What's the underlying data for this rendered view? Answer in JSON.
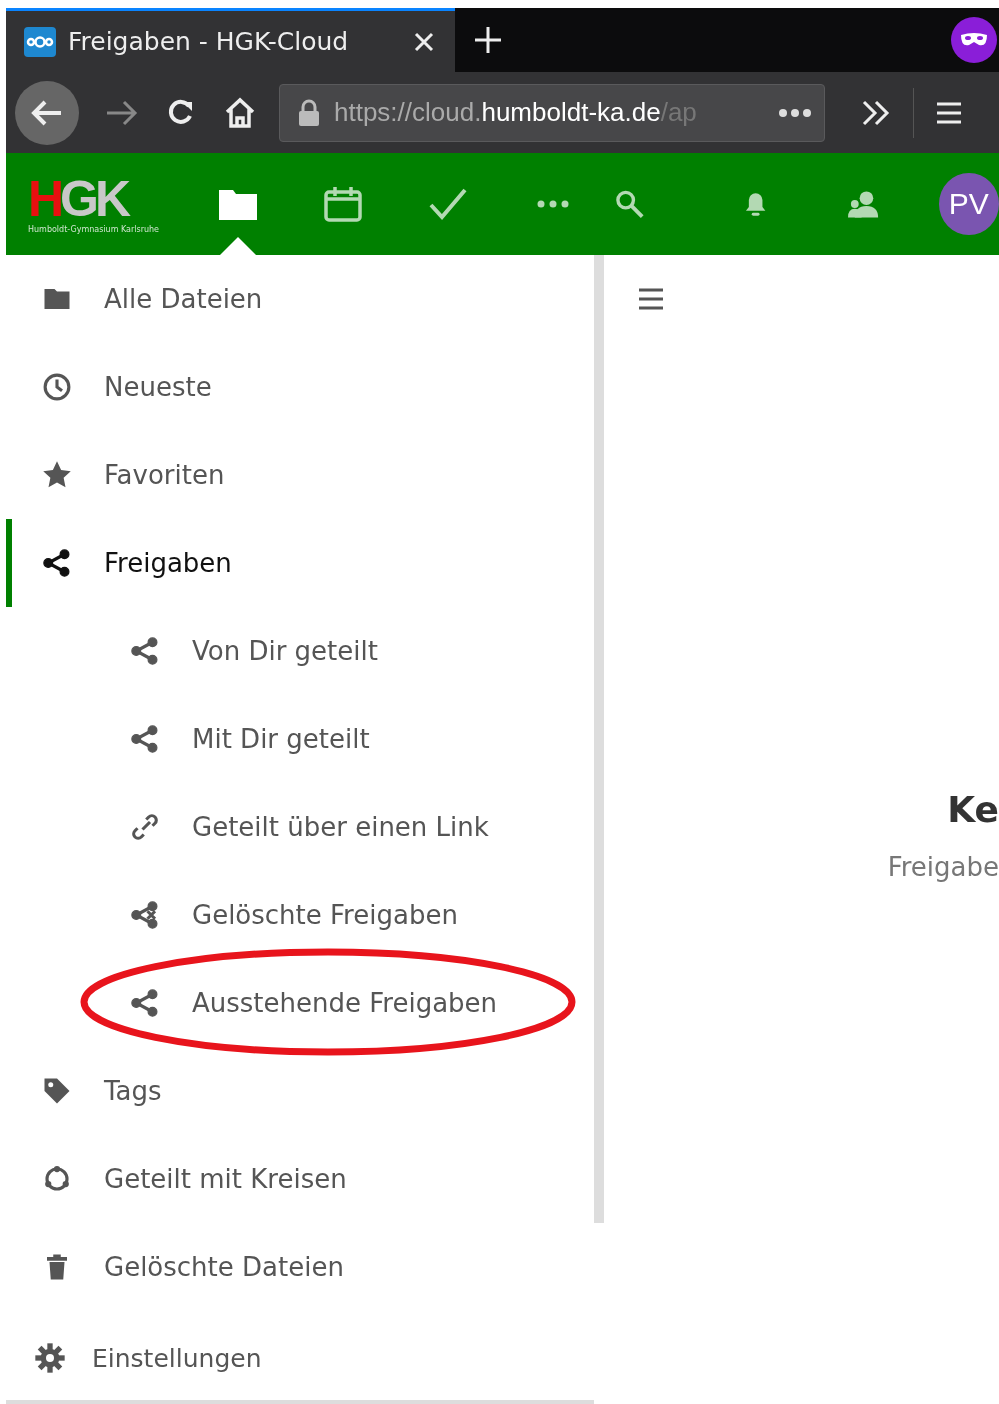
{
  "browser": {
    "tab": {
      "title": "Freigaben - HGK-Cloud",
      "selected": true
    },
    "url": {
      "prefix": "https://cloud.",
      "domain": "humboldt-ka.de",
      "suffix": "/ap"
    }
  },
  "header": {
    "logo_text": "HGK",
    "logo_subtitle": "Humboldt-Gymnasium Karlsruhe",
    "apps": [
      {
        "kind": "files",
        "selected": true
      },
      {
        "kind": "calendar",
        "selected": false
      },
      {
        "kind": "tasks",
        "selected": false
      },
      {
        "kind": "more",
        "selected": false
      }
    ],
    "avatar": "PV"
  },
  "sidebar": {
    "items": [
      {
        "kind": "folder",
        "label": "Alle Dateien",
        "selected": false
      },
      {
        "kind": "clock",
        "label": "Neueste",
        "selected": false
      },
      {
        "kind": "star",
        "label": "Favoriten",
        "selected": false
      },
      {
        "kind": "share",
        "label": "Freigaben",
        "selected": true,
        "children": [
          {
            "kind": "share",
            "label": "Von Dir geteilt",
            "selected": false,
            "circled": false
          },
          {
            "kind": "share",
            "label": "Mit Dir geteilt",
            "selected": false,
            "circled": false
          },
          {
            "kind": "link",
            "label": "Geteilt über einen Link",
            "selected": false,
            "circled": false
          },
          {
            "kind": "share-deleted",
            "label": "Gelöschte Freigaben",
            "selected": false,
            "circled": false
          },
          {
            "kind": "share",
            "label": "Ausstehende Freigaben",
            "selected": false,
            "circled": true
          }
        ]
      },
      {
        "kind": "tag",
        "label": "Tags",
        "selected": false
      },
      {
        "kind": "circles",
        "label": "Geteilt mit Kreisen",
        "selected": false
      },
      {
        "kind": "trash",
        "label": "Gelöschte Dateien",
        "selected": false
      }
    ],
    "settings": "Einstellungen"
  },
  "content": {
    "empty_title": "Ke",
    "empty_text": "Freigabe"
  }
}
